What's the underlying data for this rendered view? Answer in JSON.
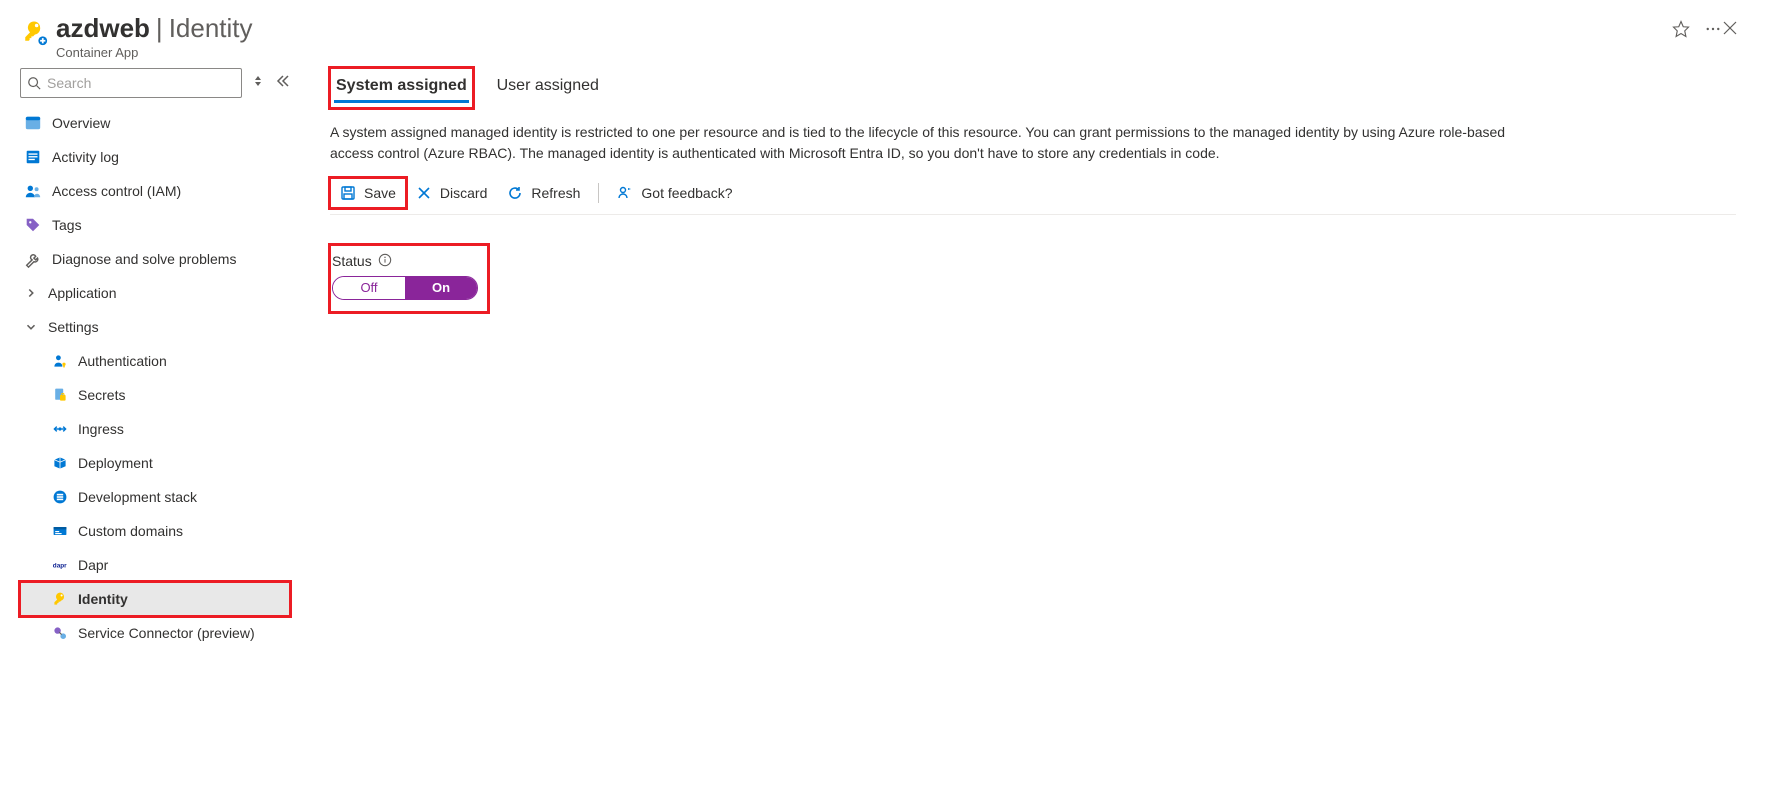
{
  "header": {
    "app_name": "azdweb",
    "section": "Identity",
    "resource_type": "Container App"
  },
  "sidebar": {
    "search_placeholder": "Search",
    "items": [
      {
        "label": "Overview"
      },
      {
        "label": "Activity log"
      },
      {
        "label": "Access control (IAM)"
      },
      {
        "label": "Tags"
      },
      {
        "label": "Diagnose and solve problems"
      }
    ],
    "groups": [
      {
        "label": "Application",
        "expanded": false
      },
      {
        "label": "Settings",
        "expanded": true,
        "children": [
          {
            "label": "Authentication"
          },
          {
            "label": "Secrets"
          },
          {
            "label": "Ingress"
          },
          {
            "label": "Deployment"
          },
          {
            "label": "Development stack"
          },
          {
            "label": "Custom domains"
          },
          {
            "label": "Dapr"
          },
          {
            "label": "Identity",
            "selected": true
          },
          {
            "label": "Service Connector (preview)"
          }
        ]
      }
    ]
  },
  "content": {
    "tabs": {
      "system": "System assigned",
      "user": "User assigned"
    },
    "description": "A system assigned managed identity is restricted to one per resource and is tied to the lifecycle of this resource. You can grant permissions to the managed identity by using Azure role-based access control (Azure RBAC). The managed identity is authenticated with Microsoft Entra ID, so you don't have to store any credentials in code.",
    "toolbar": {
      "save": "Save",
      "discard": "Discard",
      "refresh": "Refresh",
      "feedback": "Got feedback?"
    },
    "status": {
      "label": "Status",
      "off": "Off",
      "on": "On"
    }
  }
}
